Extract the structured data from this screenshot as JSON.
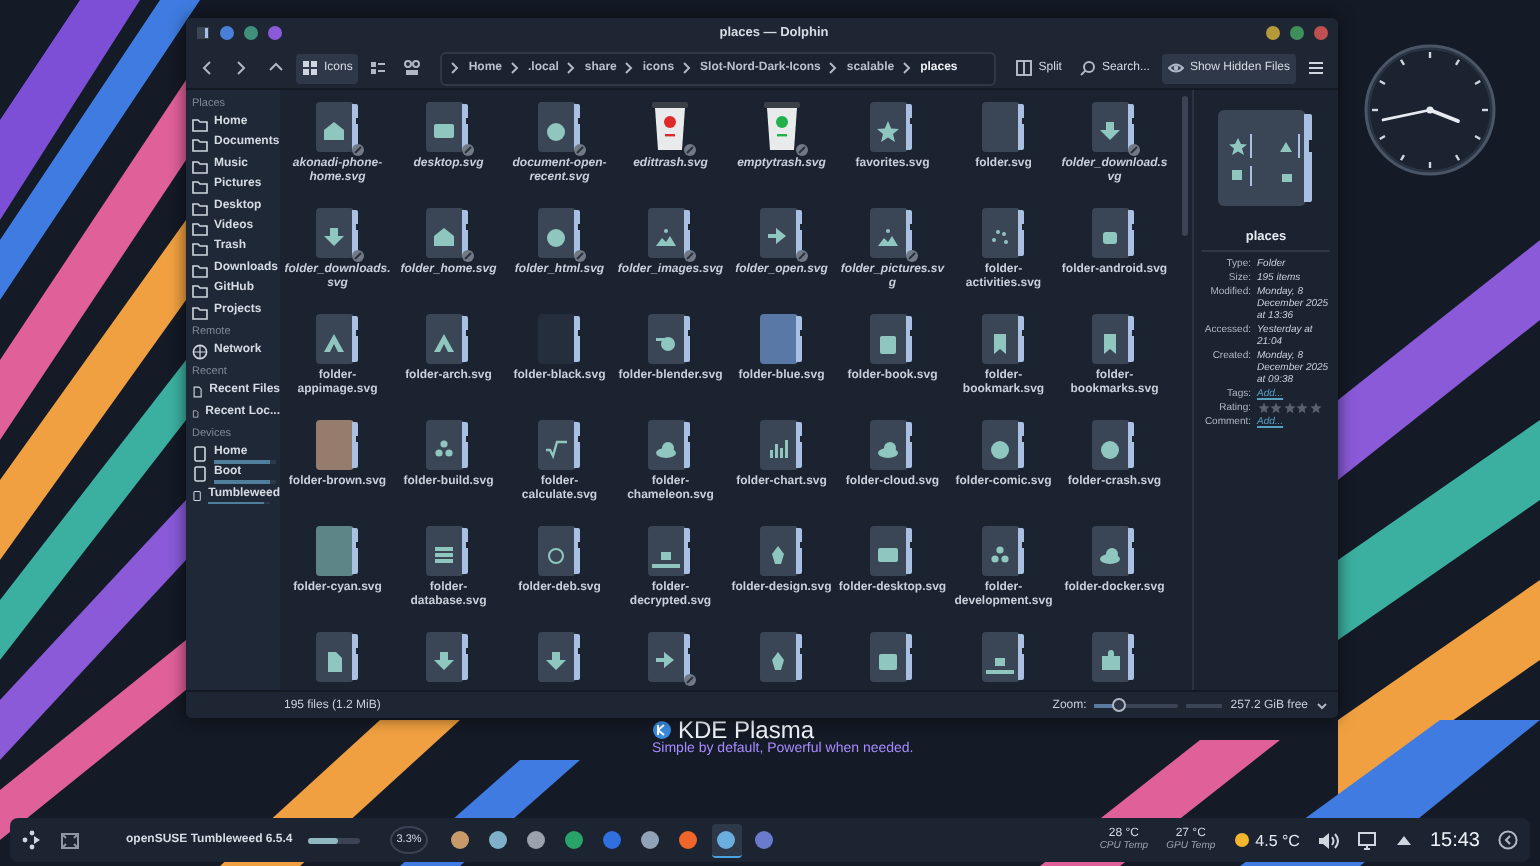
{
  "desktop": {
    "branding": {
      "title": "KDE Plasma",
      "tagline": "Simple by default, Powerful when needed."
    }
  },
  "window": {
    "title": "places — Dolphin"
  },
  "toolbar": {
    "view_modes": [
      {
        "label": "Icons",
        "selected": true
      },
      {
        "selected": false
      },
      {
        "selected": false
      }
    ],
    "breadcrumb": [
      "Home",
      ".local",
      "share",
      "icons",
      "Slot-Nord-Dark-Icons",
      "scalable",
      "places"
    ],
    "actions": [
      {
        "label": "Split",
        "checked": false
      },
      {
        "label": "Search...",
        "checked": false
      },
      {
        "label": "Show Hidden Files",
        "checked": true
      }
    ]
  },
  "sidebar": {
    "sections": [
      {
        "title": "Places",
        "kind": "places",
        "items": [
          {
            "label": "Home",
            "selected": false
          },
          {
            "label": "Documents",
            "selected": false
          },
          {
            "label": "Music",
            "selected": false
          },
          {
            "label": "Pictures",
            "selected": false
          },
          {
            "label": "Desktop",
            "selected": false
          },
          {
            "label": "Videos",
            "selected": false
          },
          {
            "label": "Trash",
            "selected": false
          },
          {
            "label": "Downloads",
            "selected": false
          },
          {
            "label": "GitHub",
            "selected": false
          },
          {
            "label": "Projects",
            "selected": false
          }
        ]
      },
      {
        "title": "Remote",
        "kind": "remote",
        "items": [
          {
            "label": "Network",
            "selected": false
          }
        ]
      },
      {
        "title": "Recent",
        "kind": "recent",
        "items": [
          {
            "label": "Recent Files",
            "selected": false
          },
          {
            "label": "Recent Loc...",
            "selected": false
          }
        ]
      },
      {
        "title": "Devices",
        "kind": "devices",
        "items": [
          {
            "label": "Home",
            "selected": false,
            "level": 0.9
          },
          {
            "label": "Boot",
            "selected": false,
            "level": 0.9
          },
          {
            "label": "Tumbleweed",
            "selected": false,
            "level": 0.9
          }
        ]
      }
    ]
  },
  "files": [
    {
      "label": "akonadi-phone-home.svg",
      "kind": "home",
      "color": "#3a4656",
      "link": true
    },
    {
      "label": "desktop.svg",
      "kind": "screen",
      "color": "#3a4656",
      "link": true
    },
    {
      "label": "document-open-recent.svg",
      "kind": "clock",
      "color": "#3a4656",
      "link": true
    },
    {
      "label": "edittrash.svg",
      "kind": "trash",
      "color": "#e02a2a",
      "link": true
    },
    {
      "label": "emptytrash.svg",
      "kind": "trash",
      "color": "#22b04a",
      "link": true
    },
    {
      "label": "favorites.svg",
      "kind": "star",
      "color": "#3a4656",
      "link": false
    },
    {
      "label": "folder.svg",
      "kind": "plain",
      "color": "#3a4656",
      "link": false
    },
    {
      "label": "folder_download.svg",
      "kind": "down",
      "color": "#3a4656",
      "link": true
    },
    {
      "label": "folder_downloads.svg",
      "kind": "down",
      "color": "#3a4656",
      "link": true
    },
    {
      "label": "folder_home.svg",
      "kind": "home",
      "color": "#3a4656",
      "link": true
    },
    {
      "label": "folder_html.svg",
      "kind": "globe",
      "color": "#3a4656",
      "link": true
    },
    {
      "label": "folder_images.svg",
      "kind": "image",
      "color": "#3a4656",
      "link": true
    },
    {
      "label": "folder_open.svg",
      "kind": "right",
      "color": "#3a4656",
      "link": true
    },
    {
      "label": "folder_pictures.svg",
      "kind": "image",
      "color": "#3a4656",
      "link": true
    },
    {
      "label": "folder-activities.svg",
      "kind": "dots",
      "color": "#3a4656",
      "link": false
    },
    {
      "label": "folder-android.svg",
      "kind": "android",
      "color": "#3a4656",
      "link": false
    },
    {
      "label": "folder-appimage.svg",
      "kind": "letter",
      "color": "#3a4656",
      "link": false
    },
    {
      "label": "folder-arch.svg",
      "kind": "letter",
      "color": "#3a4656",
      "link": false
    },
    {
      "label": "folder-black.svg",
      "kind": "plain",
      "color": "#252e3c",
      "link": false
    },
    {
      "label": "folder-blender.svg",
      "kind": "blender",
      "color": "#3a4656",
      "link": false
    },
    {
      "label": "folder-blue.svg",
      "kind": "plain",
      "color": "#5a78a6",
      "link": false
    },
    {
      "label": "folder-book.svg",
      "kind": "book",
      "color": "#3a4656",
      "link": false
    },
    {
      "label": "folder-bookmark.svg",
      "kind": "bookmark",
      "color": "#3a4656",
      "link": false
    },
    {
      "label": "folder-bookmarks.svg",
      "kind": "bookmark",
      "color": "#3a4656",
      "link": false
    },
    {
      "label": "folder-brown.svg",
      "kind": "plain",
      "color": "#957c6c",
      "link": false
    },
    {
      "label": "folder-build.svg",
      "kind": "gears",
      "color": "#3a4656",
      "link": false
    },
    {
      "label": "folder-calculate.svg",
      "kind": "sqrt",
      "color": "#3a4656",
      "link": false
    },
    {
      "label": "folder-chameleon.svg",
      "kind": "cloud",
      "color": "#3a4656",
      "link": false
    },
    {
      "label": "folder-chart.svg",
      "kind": "chart",
      "color": "#3a4656",
      "link": false
    },
    {
      "label": "folder-cloud.svg",
      "kind": "cloud",
      "color": "#3a4656",
      "link": false
    },
    {
      "label": "folder-comic.svg",
      "kind": "face",
      "color": "#3a4656",
      "link": false
    },
    {
      "label": "folder-crash.svg",
      "kind": "face",
      "color": "#3a4656",
      "link": false
    },
    {
      "label": "folder-cyan.svg",
      "kind": "plain",
      "color": "#5d8588",
      "link": false
    },
    {
      "label": "folder-database.svg",
      "kind": "database",
      "color": "#3a4656",
      "link": false
    },
    {
      "label": "folder-deb.svg",
      "kind": "spiral",
      "color": "#3a4656",
      "link": false
    },
    {
      "label": "folder-decrypted.svg",
      "kind": "lock",
      "color": "#3a4656",
      "link": false
    },
    {
      "label": "folder-design.svg",
      "kind": "pen",
      "color": "#3a4656",
      "link": false
    },
    {
      "label": "folder-desktop.svg",
      "kind": "screen",
      "color": "#3a4656",
      "link": false
    },
    {
      "label": "folder-development.svg",
      "kind": "gears",
      "color": "#3a4656",
      "link": false
    },
    {
      "label": "folder-docker.svg",
      "kind": "cloud",
      "color": "#3a4656",
      "link": false
    },
    {
      "kind": "document",
      "color": "#3a4656",
      "link": false
    },
    {
      "kind": "down",
      "color": "#3a4656",
      "link": false
    },
    {
      "kind": "down",
      "color": "#3a4656",
      "link": false
    },
    {
      "kind": "right",
      "color": "#3a4656",
      "link": true
    },
    {
      "kind": "pen",
      "color": "#3a4656",
      "link": false
    },
    {
      "kind": "box",
      "color": "#3a4656",
      "link": false
    },
    {
      "kind": "lock",
      "color": "#3a4656",
      "link": false
    },
    {
      "kind": "puzzle",
      "color": "#3a4656",
      "link": false
    }
  ],
  "info_panel": {
    "name": "places",
    "fields": [
      {
        "label": "Type:",
        "value": "Folder",
        "kind": "text"
      },
      {
        "label": "Size:",
        "value": "195 items",
        "kind": "text"
      },
      {
        "label": "Modified:",
        "value": "Monday, 8 December 2025 at 13:36",
        "kind": "text"
      },
      {
        "label": "Accessed:",
        "value": "Yesterday at 21:04",
        "kind": "text"
      },
      {
        "label": "Created:",
        "value": "Monday, 8 December 2025 at 09:38",
        "kind": "text"
      },
      {
        "label": "Tags:",
        "value": "Add...",
        "kind": "link"
      },
      {
        "label": "Rating:",
        "stars": 0,
        "kind": "rating"
      },
      {
        "label": "Comment:",
        "value": "Add...",
        "kind": "link"
      }
    ]
  },
  "status_bar": {
    "summary": "195 files (1.2 MiB)",
    "zoom_label": "Zoom:",
    "zoom": {
      "level": 0.3
    },
    "free_space": "257.2 GiB free"
  },
  "taskbar": {
    "task": {
      "label": "openSUSE Tumbleweed 6.5.4",
      "level": 0.55
    },
    "cpu": "3.3%",
    "apps": [
      {
        "color": "#c89a6a",
        "selected": false
      },
      {
        "color": "#7fb0c8",
        "selected": false
      },
      {
        "color": "#9aa3ad",
        "selected": false
      },
      {
        "color": "#2aa36b",
        "selected": false
      },
      {
        "color": "#2f6fe0",
        "selected": false
      },
      {
        "color": "#8fa2b8",
        "selected": false
      },
      {
        "color": "#f0652a",
        "selected": false
      },
      {
        "color": "#6aaee0",
        "selected": true
      },
      {
        "color": "#6a7acc",
        "selected": false
      }
    ],
    "sensors": [
      {
        "value": "28 °C",
        "label": "CPU Temp"
      },
      {
        "value": "27 °C",
        "label": "GPU Temp"
      }
    ],
    "weather": "4.5 °C",
    "time": "15:43"
  }
}
